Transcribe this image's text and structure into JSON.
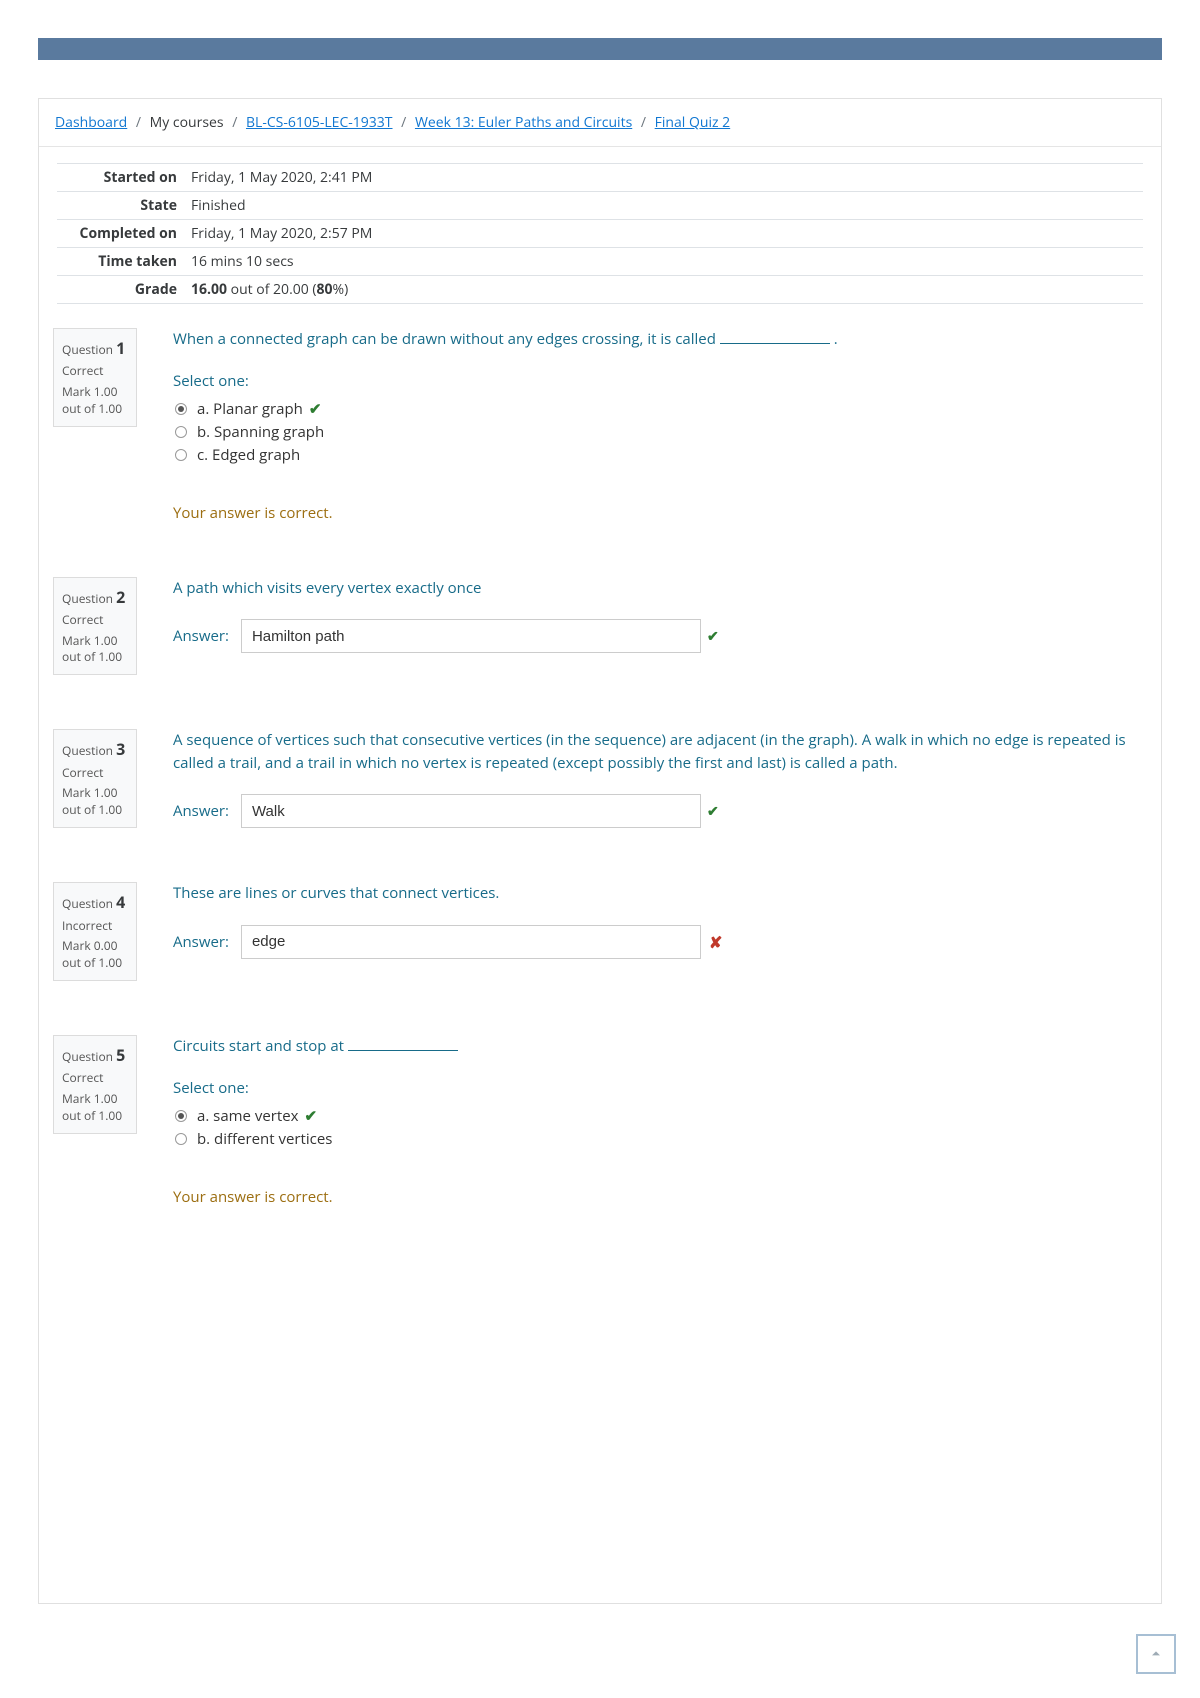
{
  "breadcrumb": {
    "dashboard": "Dashboard",
    "my_courses": "My courses",
    "course_code": "BL-CS-6105-LEC-1933T",
    "week": "Week 13: Euler Paths and Circuits",
    "quiz": "Final Quiz 2"
  },
  "summary": {
    "started_label": "Started on",
    "started_val": "Friday, 1 May 2020, 2:41 PM",
    "state_label": "State",
    "state_val": "Finished",
    "completed_label": "Completed on",
    "completed_val": "Friday, 1 May 2020, 2:57 PM",
    "time_label": "Time taken",
    "time_val": "16 mins 10 secs",
    "grade_label": "Grade",
    "grade_strong1": "16.00",
    "grade_mid": " out of 20.00 (",
    "grade_strong2": "80",
    "grade_after": "%)"
  },
  "q1": {
    "label": "Question",
    "no": "1",
    "state": "Correct",
    "mark": "Mark 1.00 out of 1.00",
    "stem_pre": "When a connected graph can be drawn without any edges crossing, it is called ",
    "stem_post": " .",
    "select": "Select one:",
    "opt_a": "a. Planar graph",
    "opt_b": "b. Spanning graph",
    "opt_c": "c. Edged graph",
    "feedback": "Your answer is correct."
  },
  "q2": {
    "label": "Question",
    "no": "2",
    "state": "Correct",
    "mark": "Mark 1.00 out of 1.00",
    "stem": "A path which visits every vertex exactly once",
    "ans_label": "Answer:",
    "ans_val": "Hamilton path"
  },
  "q3": {
    "label": "Question",
    "no": "3",
    "state": "Correct",
    "mark": "Mark 1.00 out of 1.00",
    "stem": "A sequence of vertices such that consecutive vertices (in the sequence) are adjacent (in the graph). A walk in which no edge is repeated is called a trail, and a trail in which no vertex is repeated (except possibly the first and last) is called a path.",
    "ans_label": "Answer:",
    "ans_val": "Walk"
  },
  "q4": {
    "label": "Question",
    "no": "4",
    "state": "Incorrect",
    "mark": "Mark 0.00 out of 1.00",
    "stem": "These are lines or curves that connect vertices.",
    "ans_label": "Answer:",
    "ans_val": "edge"
  },
  "q5": {
    "label": "Question",
    "no": "5",
    "state": "Correct",
    "mark": "Mark 1.00 out of 1.00",
    "stem_pre": "Circuits start and stop at ",
    "select": "Select one:",
    "opt_a": "a. same vertex",
    "opt_b": "b.  different vertices",
    "feedback": "Your answer is correct."
  }
}
